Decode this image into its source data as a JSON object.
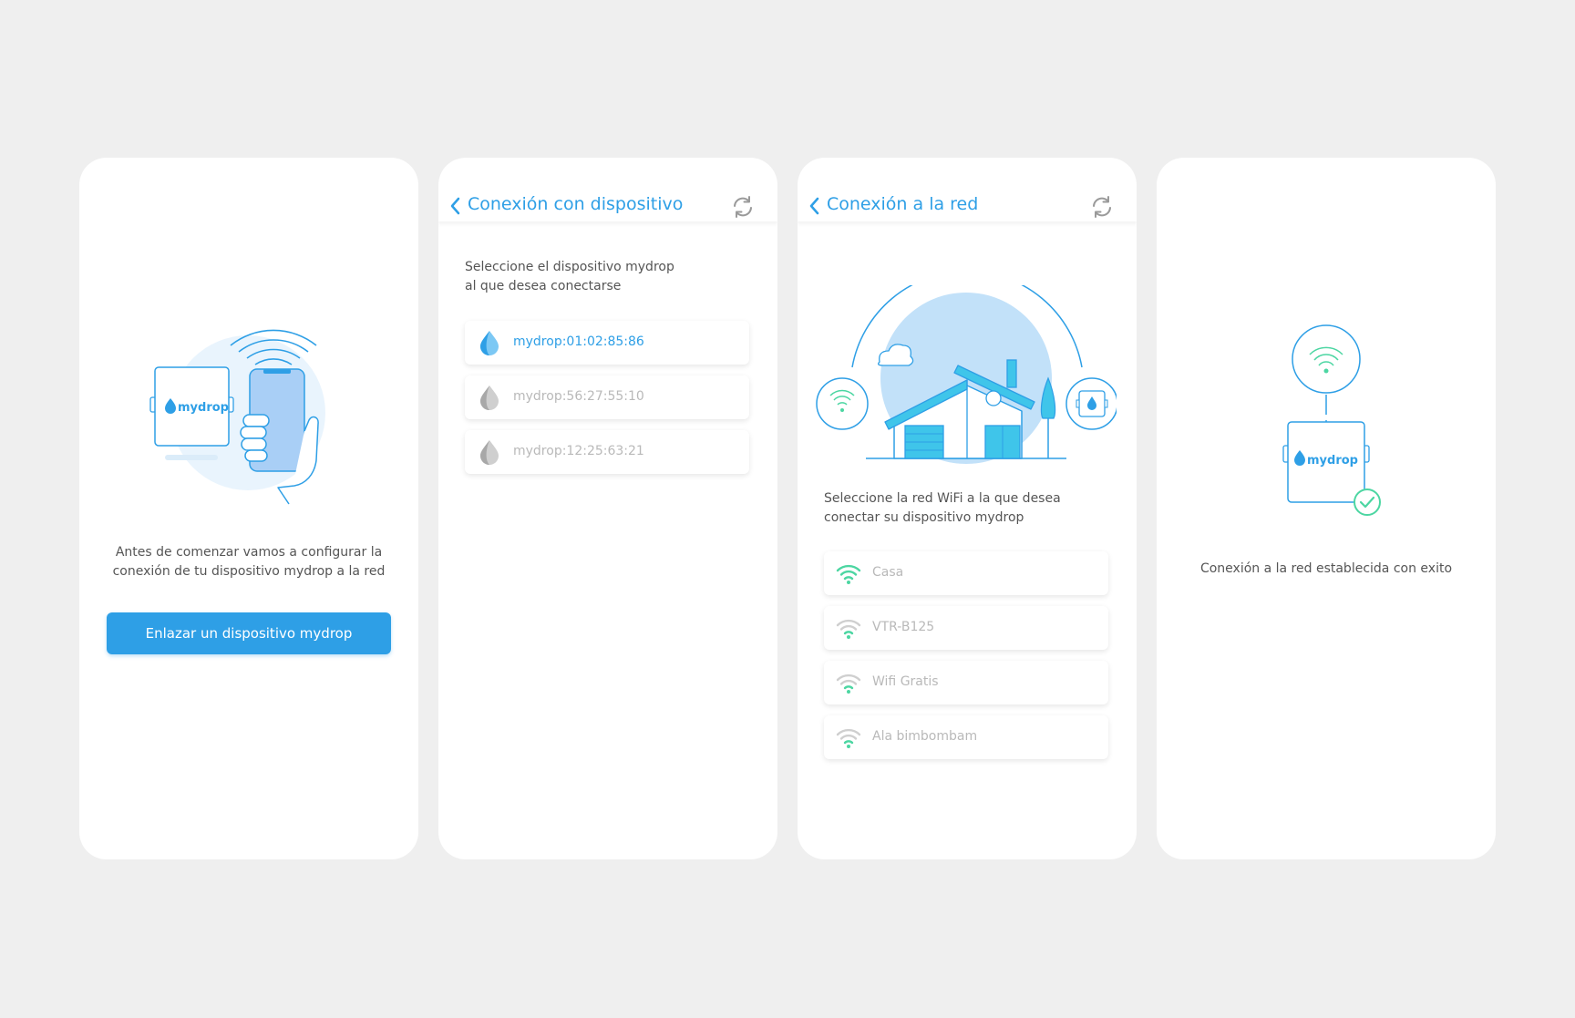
{
  "colors": {
    "accent": "#2e9fe6",
    "success": "#4cd6a2",
    "inactive": "#b9b9b9",
    "background": "#efefef",
    "illustration_light": "#c2e1f9"
  },
  "screen1": {
    "device_logo": "mydrop",
    "intro_line1": "Antes de comenzar vamos a configurar la",
    "intro_line2": "conexión de tu dispositivo mydrop a la red",
    "link_button": "Enlazar un dispositivo mydrop"
  },
  "screen2": {
    "title": "Conexión con dispositivo",
    "back_icon": "chevron-left-icon",
    "refresh_icon": "refresh-icon",
    "prompt_line1": "Seleccione el dispositivo mydrop",
    "prompt_line2": "al que desea conectarse",
    "devices": [
      {
        "label": "mydrop:01:02:85:86",
        "icon": "drop-icon",
        "selected": true
      },
      {
        "label": "mydrop:56:27:55:10",
        "icon": "drop-icon",
        "selected": false
      },
      {
        "label": "mydrop:12:25:63:21",
        "icon": "drop-icon",
        "selected": false
      }
    ]
  },
  "screen3": {
    "title": "Conexión a la red",
    "back_icon": "chevron-left-icon",
    "refresh_icon": "refresh-icon",
    "prompt_line1": "Seleccione la red WiFi a la que desea",
    "prompt_line2": "conectar su dispositivo mydrop",
    "networks": [
      {
        "label": "Casa",
        "icon": "wifi-icon",
        "active": true
      },
      {
        "label": "VTR-B125",
        "icon": "wifi-icon",
        "active": false
      },
      {
        "label": "Wifi Gratis",
        "icon": "wifi-icon",
        "active": false
      },
      {
        "label": "Ala bimbombam",
        "icon": "wifi-icon",
        "active": false
      }
    ]
  },
  "screen4": {
    "device_logo": "mydrop",
    "success_text": "Conexión a la red establecida con exito"
  }
}
